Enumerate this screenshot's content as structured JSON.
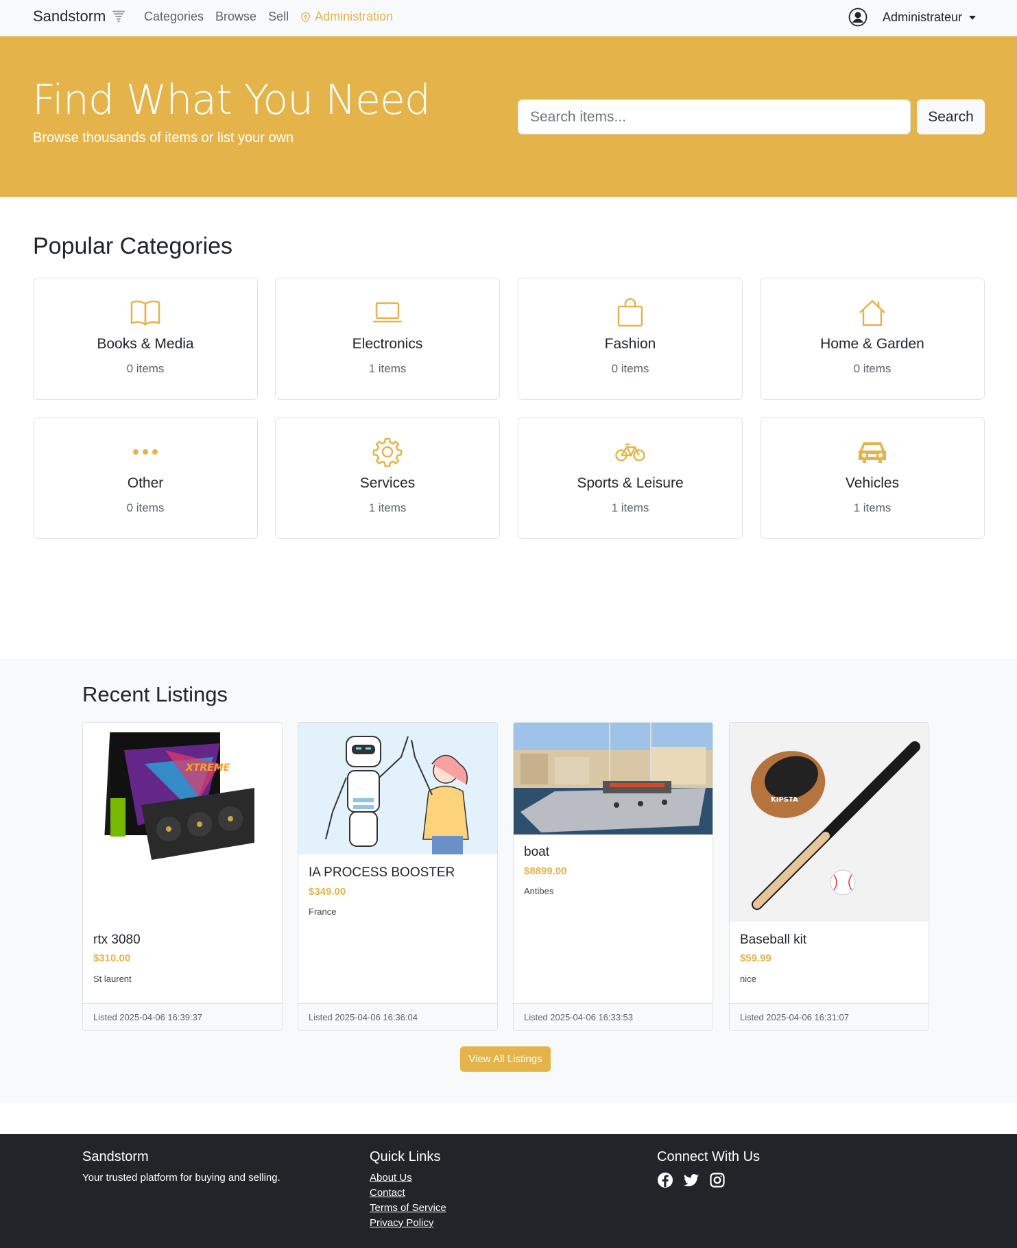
{
  "navbar": {
    "brand": "Sandstorm",
    "links": [
      "Categories",
      "Browse",
      "Sell"
    ],
    "admin_link": "Administration",
    "user_name": "Administrateur"
  },
  "hero": {
    "title": "Find What You Need",
    "subtitle": "Browse thousands of items or list your own",
    "search_placeholder": "Search items...",
    "search_button": "Search"
  },
  "categories": {
    "title": "Popular Categories",
    "items": [
      {
        "name": "Books & Media",
        "count": "0 items",
        "icon": "book-icon"
      },
      {
        "name": "Electronics",
        "count": "1 items",
        "icon": "laptop-icon"
      },
      {
        "name": "Fashion",
        "count": "0 items",
        "icon": "shopping-bag-icon"
      },
      {
        "name": "Home & Garden",
        "count": "0 items",
        "icon": "house-icon"
      },
      {
        "name": "Other",
        "count": "0 items",
        "icon": "three-dots-icon"
      },
      {
        "name": "Services",
        "count": "1 items",
        "icon": "gear-icon"
      },
      {
        "name": "Sports & Leisure",
        "count": "1 items",
        "icon": "bicycle-icon"
      },
      {
        "name": "Vehicles",
        "count": "1 items",
        "icon": "car-icon"
      }
    ]
  },
  "recent": {
    "title": "Recent Listings",
    "listings": [
      {
        "title": "rtx 3080",
        "price": "$310.00",
        "location": "St laurent",
        "listed": "Listed 2025-04-06 16:39:37",
        "image": "graphics-card-image"
      },
      {
        "title": "IA PROCESS BOOSTER",
        "price": "$349.00",
        "location": "France",
        "listed": "Listed 2025-04-06 16:36:04",
        "image": "robot-high-five-image"
      },
      {
        "title": "boat",
        "price": "$8899.00",
        "location": "Antibes",
        "listed": "Listed 2025-04-06 16:33:53",
        "image": "boat-harbor-image"
      },
      {
        "title": "Baseball kit",
        "price": "$59.99",
        "location": "nice",
        "listed": "Listed 2025-04-06 16:31:07",
        "image": "baseball-kit-image"
      }
    ],
    "view_all": "View All Listings"
  },
  "footer": {
    "brand": "Sandstorm",
    "tagline": "Your trusted platform for buying and selling.",
    "quick_links_title": "Quick Links",
    "quick_links": [
      "About Us",
      "Contact",
      "Terms of Service",
      "Privacy Policy"
    ],
    "connect_title": "Connect With Us",
    "social_icons": [
      "facebook-icon",
      "twitter-icon",
      "instagram-icon"
    ]
  },
  "colors": {
    "accent": "#e4b44a",
    "navbar_bg": "#f8f9fa",
    "footer_bg": "#212529"
  }
}
